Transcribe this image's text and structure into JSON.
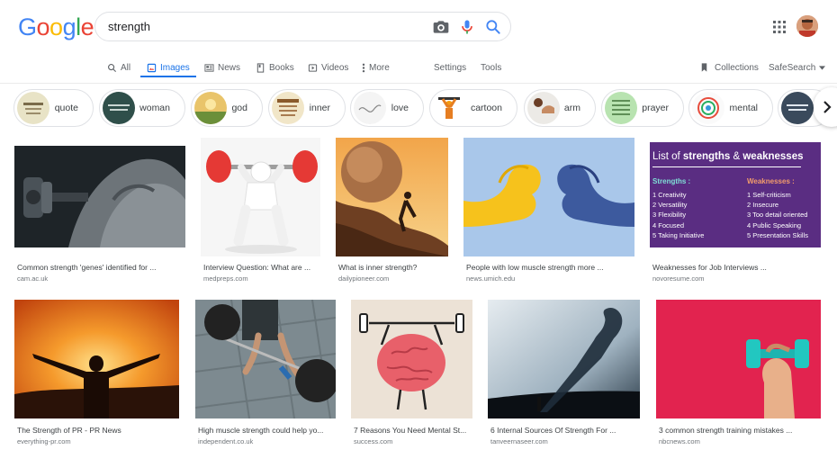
{
  "logo": {
    "letters": [
      "G",
      "o",
      "o",
      "g",
      "l",
      "e"
    ]
  },
  "search": {
    "query": "strength"
  },
  "tabs": [
    {
      "label": "All"
    },
    {
      "label": "Images"
    },
    {
      "label": "News"
    },
    {
      "label": "Books"
    },
    {
      "label": "Videos"
    },
    {
      "label": "More"
    }
  ],
  "tools": {
    "settings": "Settings",
    "tools": "Tools",
    "collections": "Collections",
    "safesearch": "SafeSearch"
  },
  "chips": [
    {
      "label": "quote"
    },
    {
      "label": "woman"
    },
    {
      "label": "god"
    },
    {
      "label": "inner"
    },
    {
      "label": "love"
    },
    {
      "label": "cartoon"
    },
    {
      "label": "arm"
    },
    {
      "label": "prayer"
    },
    {
      "label": "mental"
    }
  ],
  "results": [
    {
      "title": "Common strength 'genes' identified for ...",
      "source": "cam.ac.uk"
    },
    {
      "title": "Interview Question: What are ...",
      "source": "medpreps.com"
    },
    {
      "title": "What is inner strength?",
      "source": "dailypioneer.com"
    },
    {
      "title": "People with low muscle strength more ...",
      "source": "news.umich.edu"
    },
    {
      "title": "Weaknesses for Job Interviews ...",
      "source": "novoresume.com"
    },
    {
      "title": "The Strength of PR - PR News",
      "source": "everything-pr.com"
    },
    {
      "title": "High muscle strength could help yo...",
      "source": "independent.co.uk"
    },
    {
      "title": "7 Reasons You Need Mental St...",
      "source": "success.com"
    },
    {
      "title": "6 Internal Sources Of Strength For ...",
      "source": "tanveernaseer.com"
    },
    {
      "title": "3 common strength training mistakes ...",
      "source": "nbcnews.com"
    }
  ],
  "infographic": {
    "title_prefix": "List of ",
    "title_strengths": "strengths",
    "title_amp": " & ",
    "title_weaknesses": "weaknesses",
    "strengths_heading": "Strengths :",
    "weaknesses_heading": "Weaknesses :",
    "strengths": [
      "1  Creativity",
      "2  Versatility",
      "3  Flexibility",
      "4  Focused",
      "5  Taking Initiative"
    ],
    "weaknesses": [
      "1  Self-criticism",
      "2  Insecure",
      "3  Too detail oriented",
      "4  Public Speaking",
      "5  Presentation Skills"
    ]
  },
  "colors": {
    "accent": "#1a73e8",
    "infographic_bg": "#5a2d82"
  }
}
